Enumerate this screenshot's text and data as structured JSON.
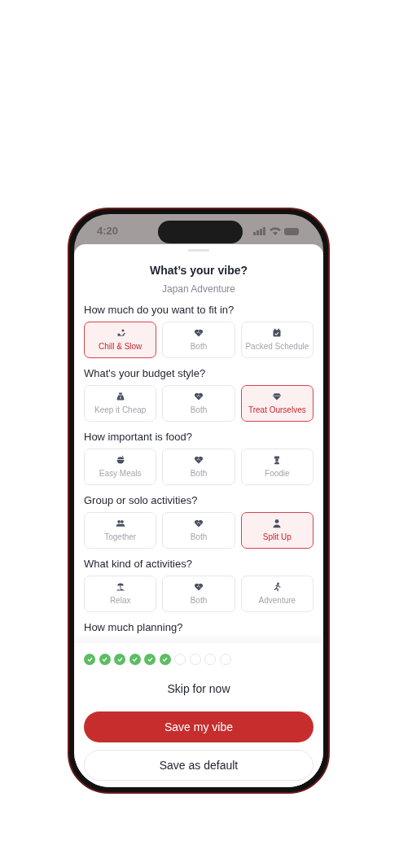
{
  "status_bar": {
    "time": "4:20"
  },
  "sheet": {
    "title": "What’s your vibe?",
    "subtitle": "Japan Adventure"
  },
  "questions": [
    {
      "label": "How much do you want to fit in?",
      "options": [
        {
          "label": "Chill & Slow",
          "selected": true
        },
        {
          "label": "Both",
          "selected": false
        },
        {
          "label": "Packed Schedule",
          "selected": false
        }
      ]
    },
    {
      "label": "What's your budget style?",
      "options": [
        {
          "label": "Keep it Cheap",
          "selected": false
        },
        {
          "label": "Both",
          "selected": false
        },
        {
          "label": "Treat Ourselves",
          "selected": true
        }
      ]
    },
    {
      "label": "How important is food?",
      "options": [
        {
          "label": "Easy Meals",
          "selected": false
        },
        {
          "label": "Both",
          "selected": false
        },
        {
          "label": "Foodie",
          "selected": false
        }
      ]
    },
    {
      "label": "Group or solo activities?",
      "options": [
        {
          "label": "Together",
          "selected": false
        },
        {
          "label": "Both",
          "selected": false
        },
        {
          "label": "Split Up",
          "selected": true
        }
      ]
    },
    {
      "label": "What kind of activities?",
      "options": [
        {
          "label": "Relax",
          "selected": false
        },
        {
          "label": "Both",
          "selected": false
        },
        {
          "label": "Adventure",
          "selected": false
        }
      ]
    },
    {
      "label": "How much planning?"
    }
  ],
  "progress": [
    {
      "done": true
    },
    {
      "done": true
    },
    {
      "done": true
    },
    {
      "done": true
    },
    {
      "done": true
    },
    {
      "done": true
    },
    {
      "done": false
    },
    {
      "done": false
    },
    {
      "done": false
    },
    {
      "done": false
    }
  ],
  "skip_link": "Skip for now",
  "buttons": [
    {
      "label": "Save my vibe",
      "kind": "primary"
    },
    {
      "label": "Save as default",
      "kind": "secondary"
    }
  ]
}
